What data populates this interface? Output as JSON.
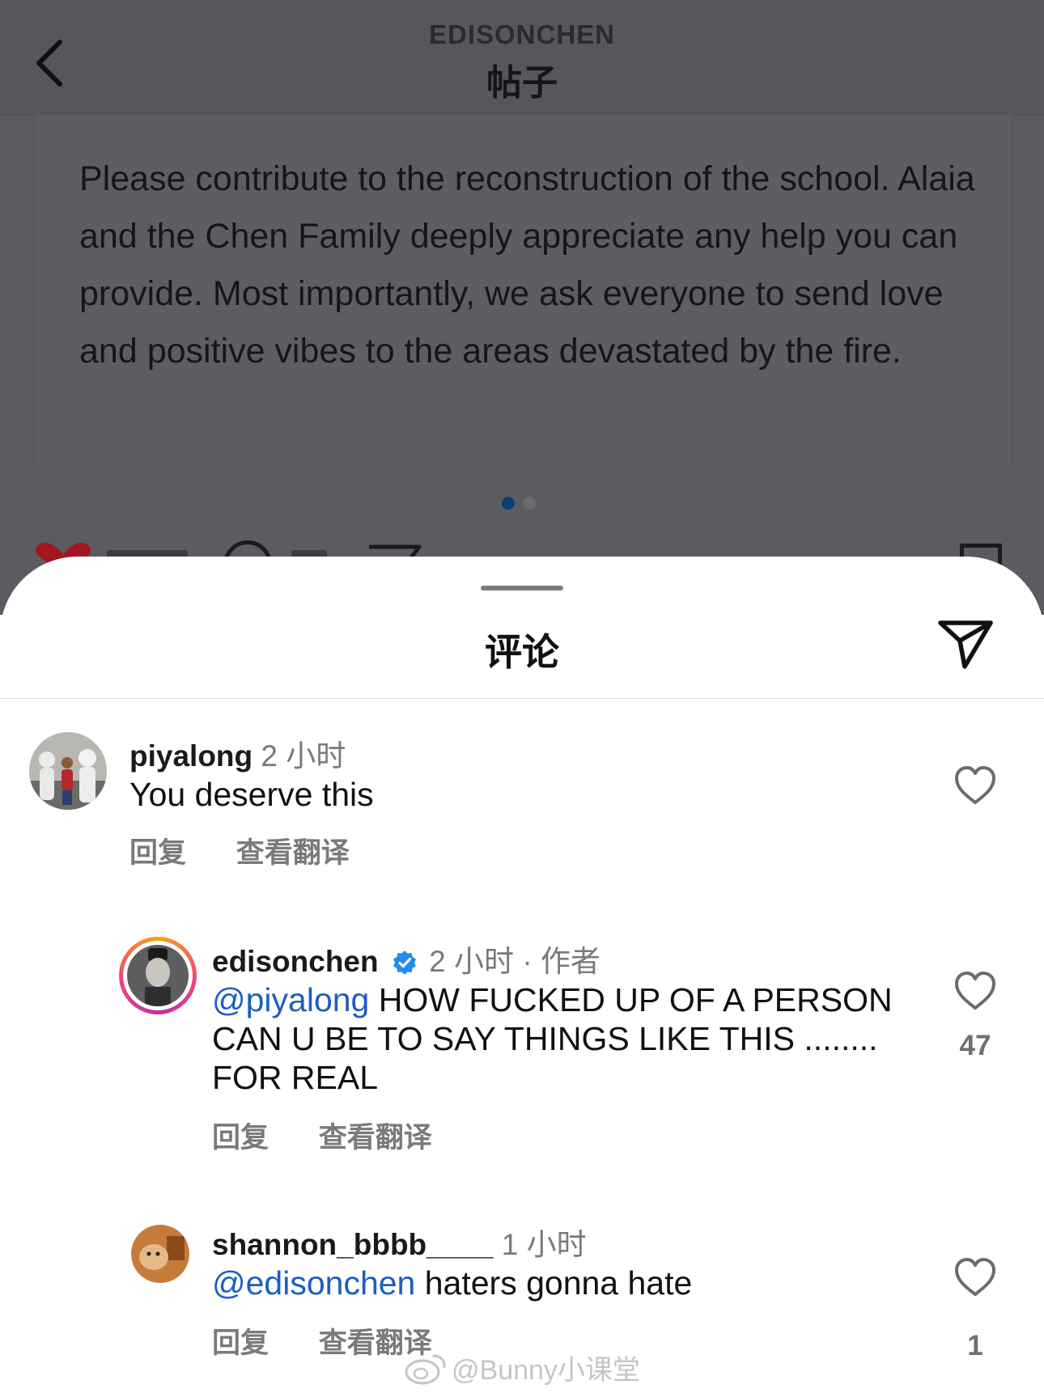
{
  "header": {
    "owner": "EDISONCHEN",
    "title": "帖子"
  },
  "post": {
    "text": "Please contribute to the reconstruction of the school. Alaia and the Chen Family deeply appreciate any help you can provide. Most importantly, we ask everyone to send love and positive vibes to the areas devastated by the fire.",
    "carousel_pages": 2,
    "carousel_active": 1
  },
  "sheet": {
    "title": "评论"
  },
  "comments": [
    {
      "username": "piyalong",
      "time": "2 小时",
      "text": "You deserve this",
      "reply_label": "回复",
      "translate_label": "查看翻译",
      "likes": ""
    },
    {
      "username": "edisonchen",
      "time": "2 小时",
      "author_tag": "· 作者",
      "mention": "@piyalong",
      "text": " HOW FUCKED UP OF A PERSON CAN U BE TO SAY THINGS LIKE THIS ........ FOR REAL",
      "reply_label": "回复",
      "translate_label": "查看翻译",
      "likes": "47"
    },
    {
      "username": "shannon_bbbb____",
      "time": "1 小时",
      "mention": "@edisonchen",
      "text": " haters gonna hate",
      "reply_label": "回复",
      "translate_label": "查看翻译",
      "likes": "1"
    }
  ],
  "watermark": "@Bunny小课堂",
  "colors": {
    "mention": "#1e5ec2",
    "verified": "#1d8cf0",
    "dim_overlay": "#5b5c61"
  }
}
